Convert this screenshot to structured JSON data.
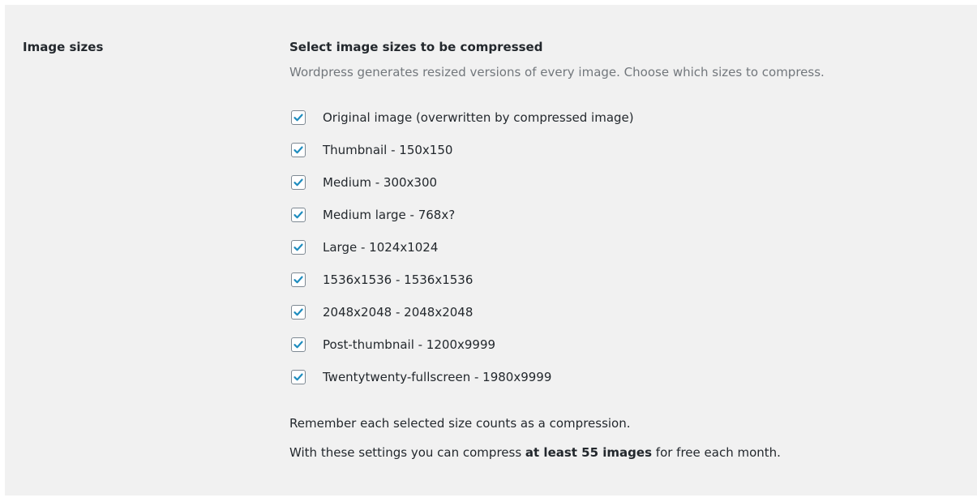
{
  "setting": {
    "row_label": "Image sizes",
    "title": "Select image sizes to be compressed",
    "description": "Wordpress generates resized versions of every image. Choose which sizes to compress."
  },
  "sizes": [
    {
      "label": "Original image (overwritten by compressed image)",
      "checked": true
    },
    {
      "label": "Thumbnail - 150x150",
      "checked": true
    },
    {
      "label": "Medium - 300x300",
      "checked": true
    },
    {
      "label": "Medium large - 768x?",
      "checked": true
    },
    {
      "label": "Large - 1024x1024",
      "checked": true
    },
    {
      "label": "1536x1536 - 1536x1536",
      "checked": true
    },
    {
      "label": "2048x2048 - 2048x2048",
      "checked": true
    },
    {
      "label": "Post-thumbnail - 1200x9999",
      "checked": true
    },
    {
      "label": "Twentytwenty-fullscreen - 1980x9999",
      "checked": true
    }
  ],
  "notes": {
    "line1": "Remember each selected size counts as a compression.",
    "line2_prefix": "With these settings you can compress ",
    "line2_strong": "at least 55 images",
    "line2_suffix": " for free each month."
  },
  "colors": {
    "panel_bg": "#f1f1f1",
    "checkmark": "#1e8cbe",
    "checkbox_border": "#7e8993",
    "description_text": "#72777c"
  },
  "icons": {
    "checkbox_checked": "checkmark-icon"
  }
}
